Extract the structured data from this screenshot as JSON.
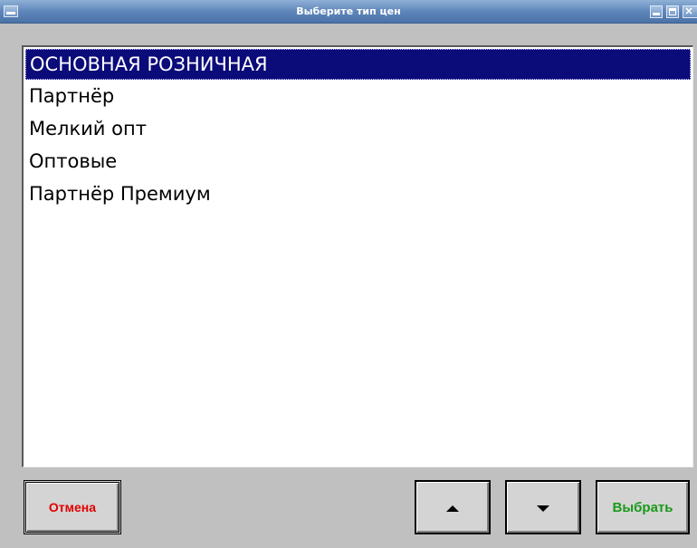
{
  "window": {
    "title": "Выберите тип цен"
  },
  "price_types": {
    "items": [
      {
        "label": "ОСНОВНАЯ РОЗНИЧНАЯ",
        "selected": true
      },
      {
        "label": "Партнёр",
        "selected": false
      },
      {
        "label": "Мелкий опт",
        "selected": false
      },
      {
        "label": "Оптовые",
        "selected": false
      },
      {
        "label": "Партнёр Премиум",
        "selected": false
      }
    ]
  },
  "buttons": {
    "cancel_label": "Отмена",
    "up_icon": "arrow-up-icon",
    "down_icon": "arrow-down-icon",
    "select_label": "Выбрать"
  },
  "colors": {
    "selection_bg": "#0b0b7a",
    "cancel_text": "#e00000",
    "select_text": "#1a9a1a",
    "titlebar": "#5f86ba",
    "background": "#c0c0c0"
  }
}
